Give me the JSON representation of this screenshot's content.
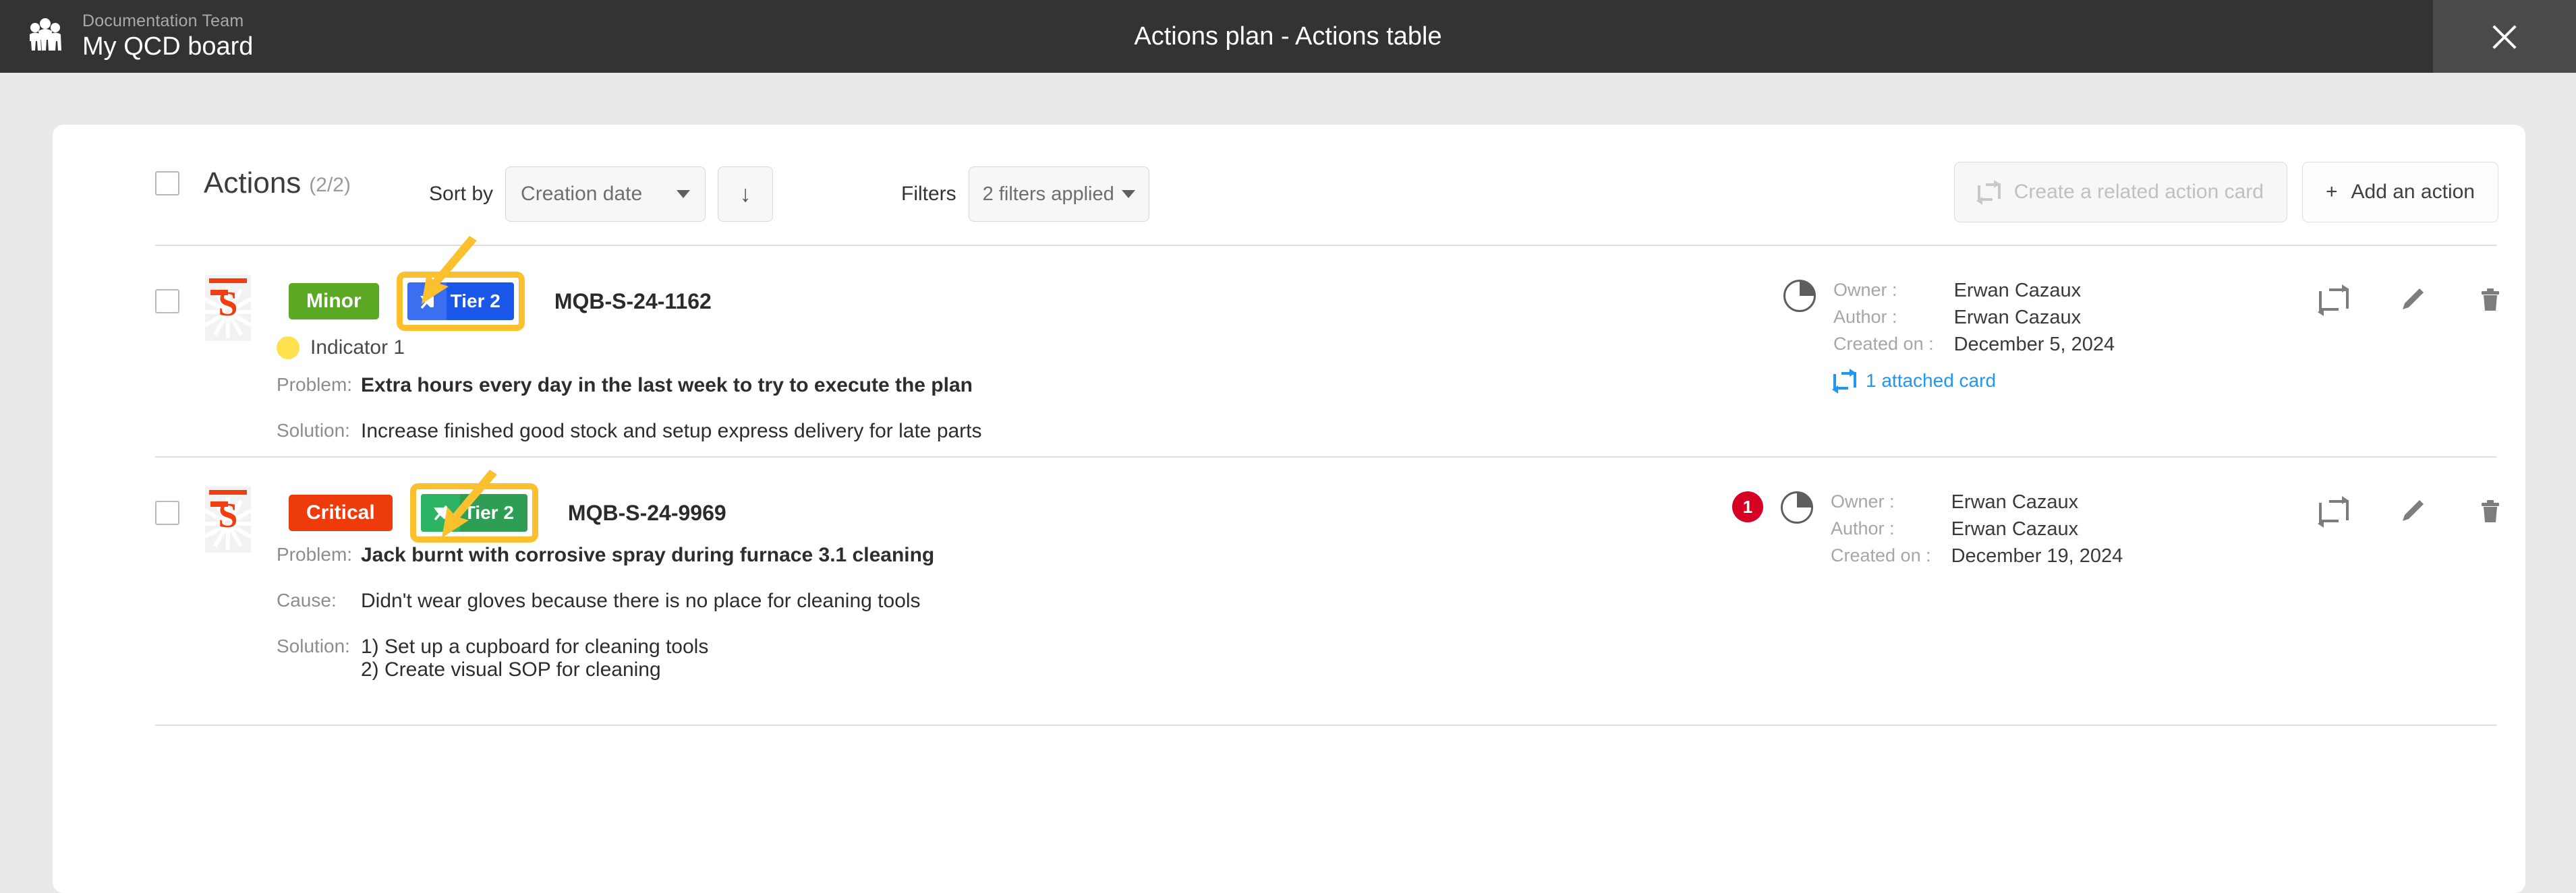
{
  "topbar": {
    "team_label": "Documentation Team",
    "board_title": "My QCD board",
    "window_title": "Actions plan - Actions table",
    "close_icon": "close-icon",
    "bg_color": "#333333"
  },
  "toolbar": {
    "select_all_checkbox": "",
    "title": "Actions",
    "count": "(2/2)",
    "sort_label": "Sort by",
    "sort_value": "Creation date",
    "sort_direction_icon": "arrow-down-icon",
    "filters_label": "Filters",
    "filters_value": "2 filters applied",
    "create_related_label": "Create a related action card",
    "add_action_label": "Add an action",
    "add_action_plus": "+"
  },
  "rows": [
    {
      "type_icon": "safety-s-icon",
      "severity": {
        "label": "Minor",
        "color": "#5aa823"
      },
      "tier": {
        "label": "Tier 2",
        "color": "#1a56e8",
        "icon_bg": "#3b6ff0",
        "icon": "tier-flag-icon",
        "highlighted": true
      },
      "reference": "MQB-S-24-1162",
      "indicator": {
        "label": "Indicator 1",
        "color": "#ffe14f"
      },
      "fields": [
        {
          "label": "Problem:",
          "value": "Extra hours every day in the last week to try to execute the plan",
          "bold": true
        },
        {
          "label": "Solution:",
          "value": "Increase finished good stock and setup express delivery for late parts",
          "bold": false
        }
      ],
      "notification_count": null,
      "progress_pct": 25,
      "owner_key": "Owner :",
      "owner_value": "Erwan Cazaux",
      "author_key": "Author :",
      "author_value": "Erwan Cazaux",
      "created_key": "Created on :",
      "created_value": "December 5, 2024",
      "attached_label": "1 attached card",
      "attached_icon": "linked-card-icon",
      "actions": [
        "repeat-icon",
        "edit-pencil-icon",
        "trash-icon"
      ]
    },
    {
      "type_icon": "safety-s-icon",
      "severity": {
        "label": "Critical",
        "color": "#ed3b0b"
      },
      "tier": {
        "label": "Tier 2",
        "color": "#2e9e55",
        "icon_bg": "#2cb464",
        "icon": "tier-flag-icon",
        "highlighted": true
      },
      "reference": "MQB-S-24-9969",
      "indicator": null,
      "fields": [
        {
          "label": "Problem:",
          "value": "Jack burnt with corrosive spray during furnace 3.1 cleaning",
          "bold": true
        },
        {
          "label": "Cause:",
          "value": "Didn't wear gloves because there is no place for cleaning tools",
          "bold": false
        },
        {
          "label": "Solution:",
          "value": "1) Set up a cupboard for cleaning tools\n2) Create visual SOP for cleaning",
          "bold": false
        }
      ],
      "notification_count": "1",
      "progress_pct": 25,
      "owner_key": "Owner :",
      "owner_value": "Erwan Cazaux",
      "author_key": "Author :",
      "author_value": "Erwan Cazaux",
      "created_key": "Created on :",
      "created_value": "December 19, 2024",
      "attached_label": null,
      "actions": [
        "repeat-icon",
        "edit-pencil-icon",
        "trash-icon"
      ]
    }
  ],
  "annotations": {
    "color": "#fbc02d",
    "arrow_1": "arrow-pointing-to-tier-badge-row-1",
    "arrow_2": "arrow-pointing-to-tier-badge-row-2"
  }
}
